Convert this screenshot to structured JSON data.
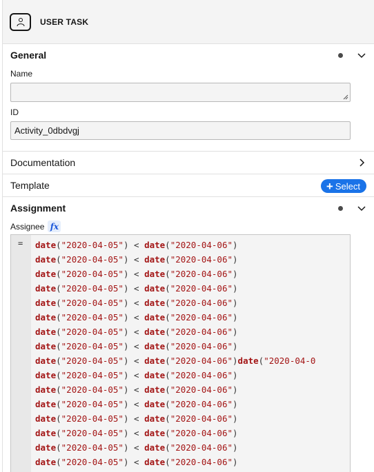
{
  "header": {
    "title": "USER TASK",
    "icon": "user-task-icon"
  },
  "general": {
    "title": "General",
    "name_label": "Name",
    "name_value": "",
    "id_label": "ID",
    "id_value": "Activity_0dbdvgj"
  },
  "documentation": {
    "title": "Documentation"
  },
  "template": {
    "title": "Template",
    "select_label": "Select"
  },
  "assignment": {
    "title": "Assignment",
    "assignee_label": "Assignee",
    "fx_label": "fx",
    "eq_symbol": "="
  },
  "editor": {
    "lines": [
      [
        [
          "kw",
          "date"
        ],
        [
          "pun",
          "("
        ],
        [
          "str",
          "\"2020-04-05\""
        ],
        [
          "pun",
          ") < "
        ],
        [
          "kw",
          "date"
        ],
        [
          "pun",
          "("
        ],
        [
          "str",
          "\"2020-04-06\""
        ],
        [
          "pun",
          ")"
        ]
      ],
      [
        [
          "kw",
          "date"
        ],
        [
          "pun",
          "("
        ],
        [
          "str",
          "\"2020-04-05\""
        ],
        [
          "pun",
          ") < "
        ],
        [
          "kw",
          "date"
        ],
        [
          "pun",
          "("
        ],
        [
          "str",
          "\"2020-04-06\""
        ],
        [
          "pun",
          ")"
        ]
      ],
      [
        [
          "kw",
          "date"
        ],
        [
          "pun",
          "("
        ],
        [
          "str",
          "\"2020-04-05\""
        ],
        [
          "pun",
          ") < "
        ],
        [
          "kw",
          "date"
        ],
        [
          "pun",
          "("
        ],
        [
          "str",
          "\"2020-04-06\""
        ],
        [
          "pun",
          ")"
        ]
      ],
      [
        [
          "kw",
          "date"
        ],
        [
          "pun",
          "("
        ],
        [
          "str",
          "\"2020-04-05\""
        ],
        [
          "pun",
          ") < "
        ],
        [
          "kw",
          "date"
        ],
        [
          "pun",
          "("
        ],
        [
          "str",
          "\"2020-04-06\""
        ],
        [
          "pun",
          ")"
        ]
      ],
      [
        [
          "kw",
          "date"
        ],
        [
          "pun",
          "("
        ],
        [
          "str",
          "\"2020-04-05\""
        ],
        [
          "pun",
          ") < "
        ],
        [
          "kw",
          "date"
        ],
        [
          "pun",
          "("
        ],
        [
          "str",
          "\"2020-04-06\""
        ],
        [
          "pun",
          ")"
        ]
      ],
      [
        [
          "kw",
          "date"
        ],
        [
          "pun",
          "("
        ],
        [
          "str",
          "\"2020-04-05\""
        ],
        [
          "pun",
          ") < "
        ],
        [
          "kw",
          "date"
        ],
        [
          "pun",
          "("
        ],
        [
          "str",
          "\"2020-04-06\""
        ],
        [
          "pun",
          ")"
        ]
      ],
      [
        [
          "kw",
          "date"
        ],
        [
          "pun",
          "("
        ],
        [
          "str",
          "\"2020-04-05\""
        ],
        [
          "pun",
          ") < "
        ],
        [
          "kw",
          "date"
        ],
        [
          "pun",
          "("
        ],
        [
          "str",
          "\"2020-04-06\""
        ],
        [
          "pun",
          ")"
        ]
      ],
      [
        [
          "kw",
          "date"
        ],
        [
          "pun",
          "("
        ],
        [
          "str",
          "\"2020-04-05\""
        ],
        [
          "pun",
          ") < "
        ],
        [
          "kw",
          "date"
        ],
        [
          "pun",
          "("
        ],
        [
          "str",
          "\"2020-04-06\""
        ],
        [
          "pun",
          ")"
        ]
      ],
      [
        [
          "kw",
          "date"
        ],
        [
          "pun",
          "("
        ],
        [
          "str",
          "\"2020-04-05\""
        ],
        [
          "pun",
          ") < "
        ],
        [
          "kw",
          "date"
        ],
        [
          "pun",
          "("
        ],
        [
          "str",
          "\"2020-04-06\""
        ],
        [
          "pun",
          ")"
        ],
        [
          "kw",
          "date"
        ],
        [
          "pun",
          "("
        ],
        [
          "str",
          "\"2020-04-0"
        ]
      ],
      [
        [
          "kw",
          "date"
        ],
        [
          "pun",
          "("
        ],
        [
          "str",
          "\"2020-04-05\""
        ],
        [
          "pun",
          ") < "
        ],
        [
          "kw",
          "date"
        ],
        [
          "pun",
          "("
        ],
        [
          "str",
          "\"2020-04-06\""
        ],
        [
          "pun",
          ")"
        ]
      ],
      [
        [
          "kw",
          "date"
        ],
        [
          "pun",
          "("
        ],
        [
          "str",
          "\"2020-04-05\""
        ],
        [
          "pun",
          ") < "
        ],
        [
          "kw",
          "date"
        ],
        [
          "pun",
          "("
        ],
        [
          "str",
          "\"2020-04-06\""
        ],
        [
          "pun",
          ")"
        ]
      ],
      [
        [
          "kw",
          "date"
        ],
        [
          "pun",
          "("
        ],
        [
          "str",
          "\"2020-04-05\""
        ],
        [
          "pun",
          ") < "
        ],
        [
          "kw",
          "date"
        ],
        [
          "pun",
          "("
        ],
        [
          "str",
          "\"2020-04-06\""
        ],
        [
          "pun",
          ")"
        ]
      ],
      [
        [
          "kw",
          "date"
        ],
        [
          "pun",
          "("
        ],
        [
          "str",
          "\"2020-04-05\""
        ],
        [
          "pun",
          ") < "
        ],
        [
          "kw",
          "date"
        ],
        [
          "pun",
          "("
        ],
        [
          "str",
          "\"2020-04-06\""
        ],
        [
          "pun",
          ")"
        ]
      ],
      [
        [
          "kw",
          "date"
        ],
        [
          "pun",
          "("
        ],
        [
          "str",
          "\"2020-04-05\""
        ],
        [
          "pun",
          ") < "
        ],
        [
          "kw",
          "date"
        ],
        [
          "pun",
          "("
        ],
        [
          "str",
          "\"2020-04-06\""
        ],
        [
          "pun",
          ")"
        ]
      ],
      [
        [
          "kw",
          "date"
        ],
        [
          "pun",
          "("
        ],
        [
          "str",
          "\"2020-04-05\""
        ],
        [
          "pun",
          ") < "
        ],
        [
          "kw",
          "date"
        ],
        [
          "pun",
          "("
        ],
        [
          "str",
          "\"2020-04-06\""
        ],
        [
          "pun",
          ")"
        ]
      ],
      [
        [
          "kw",
          "date"
        ],
        [
          "pun",
          "("
        ],
        [
          "str",
          "\"2020-04-05\""
        ],
        [
          "pun",
          ") < "
        ],
        [
          "kw",
          "date"
        ],
        [
          "pun",
          "("
        ],
        [
          "str",
          "\"2020-04-06\""
        ],
        [
          "pun",
          ")"
        ]
      ]
    ]
  },
  "colors": {
    "accent": "#1a73e8",
    "keyword": "#a31515",
    "fx_bg": "#e5eefc"
  }
}
